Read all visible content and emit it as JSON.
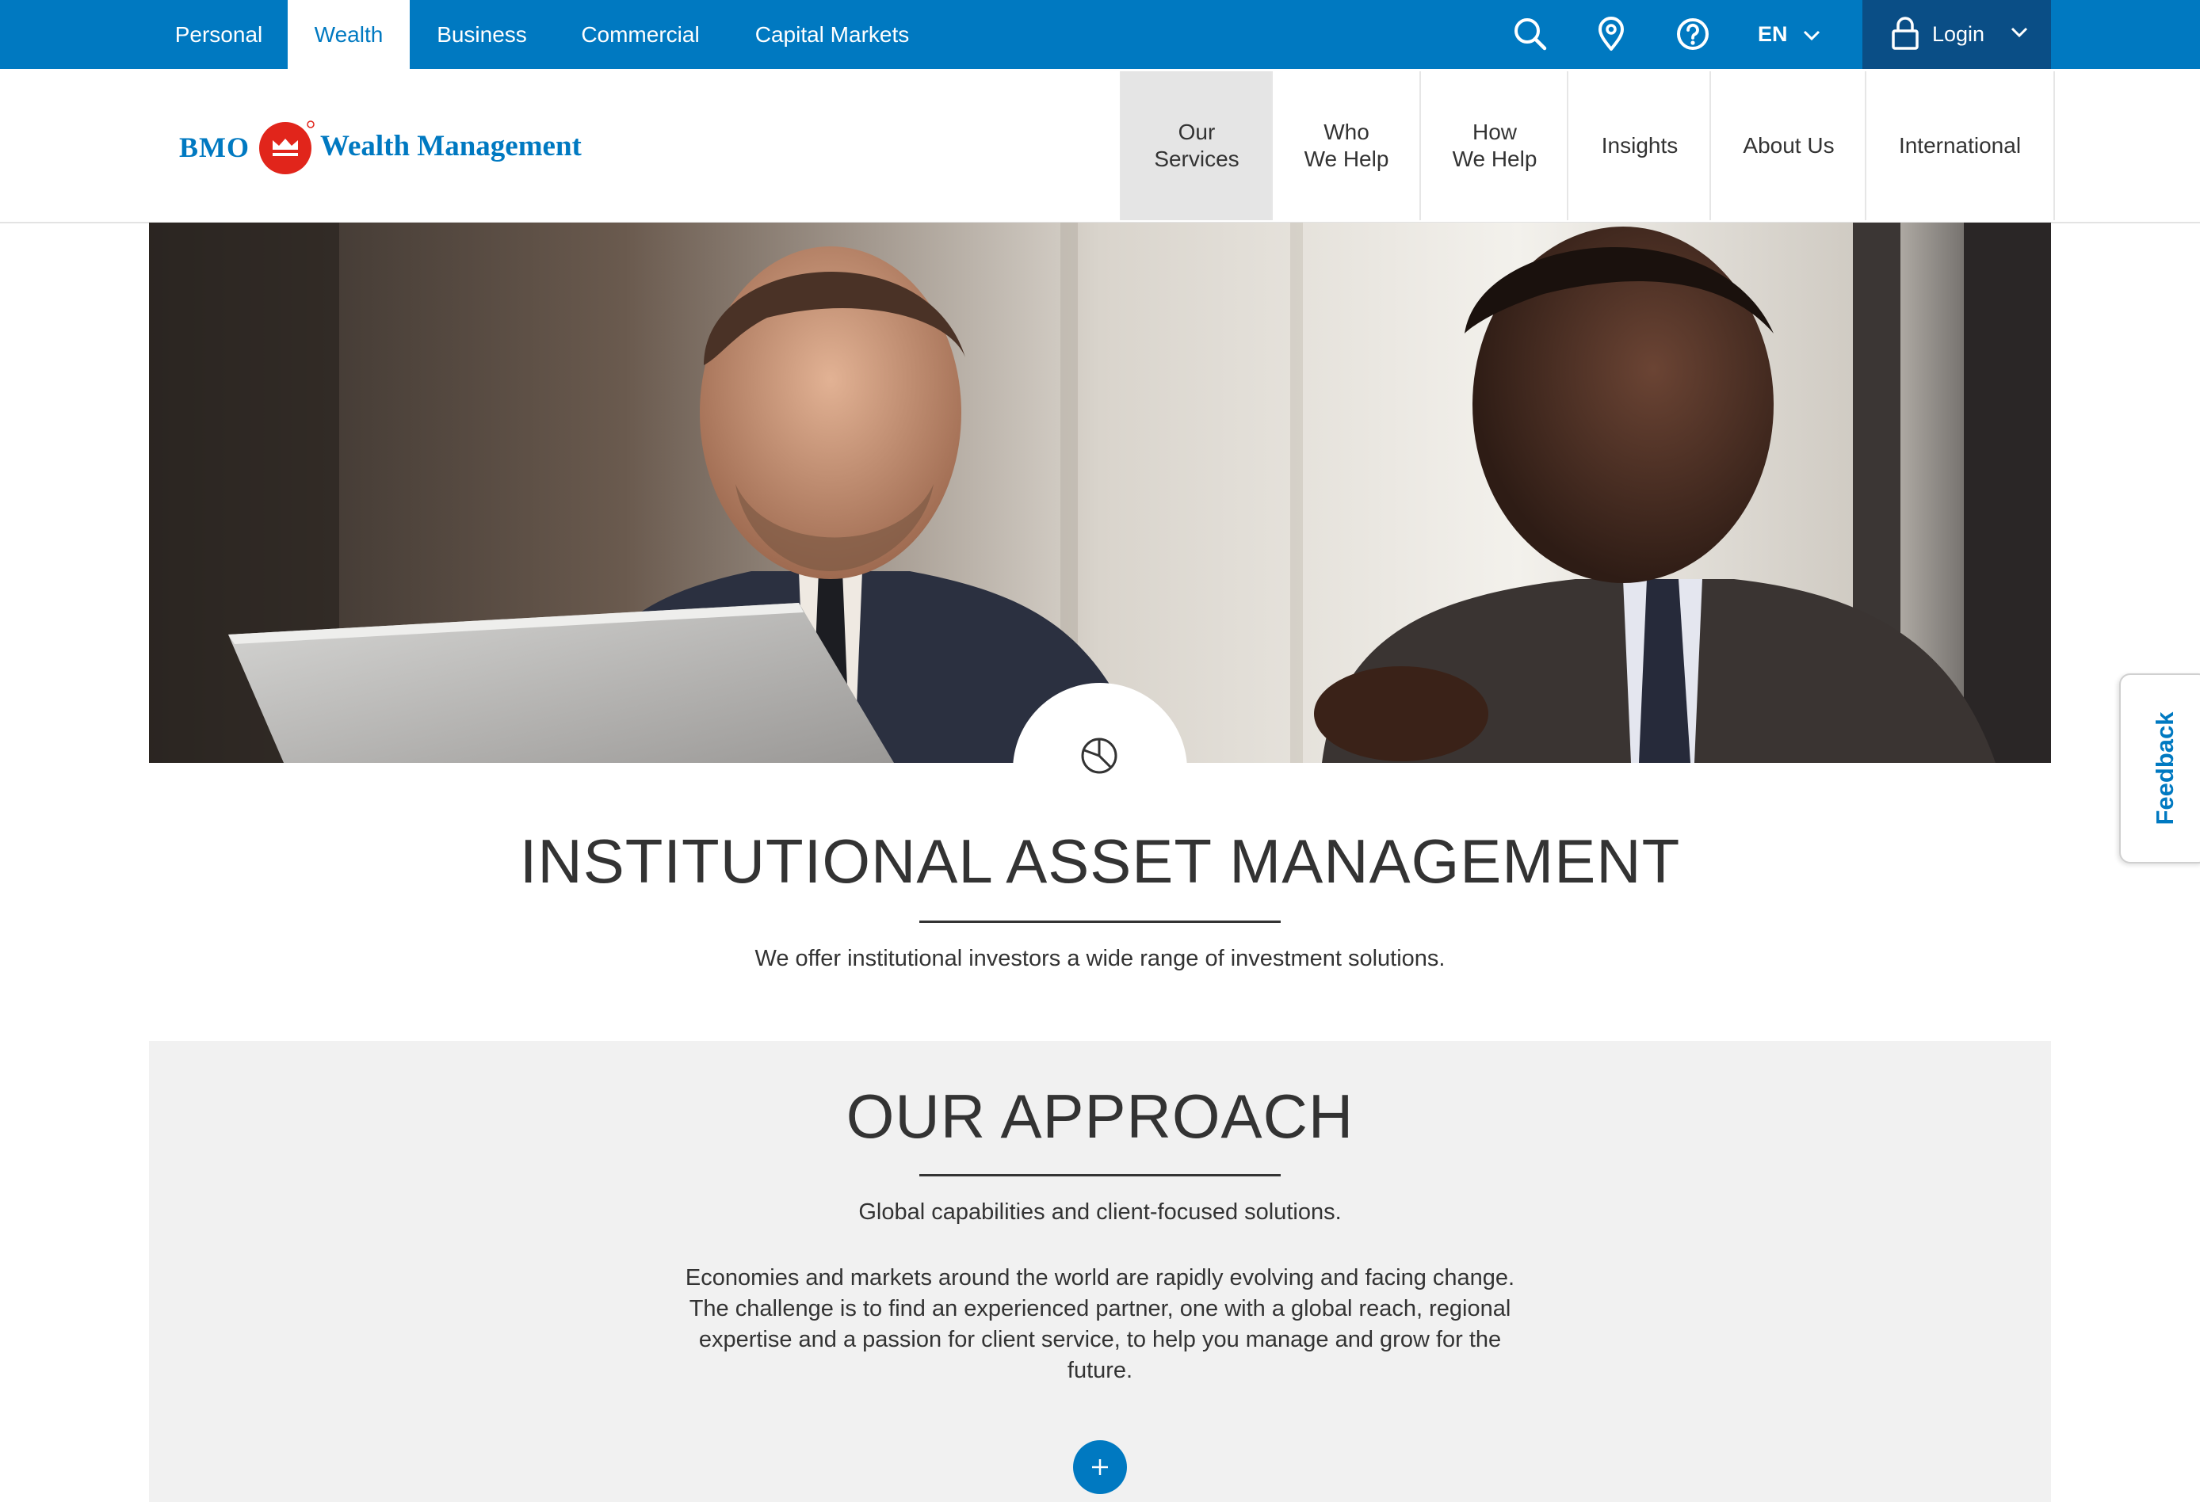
{
  "topnav": {
    "segments": [
      {
        "label": "Personal",
        "active": false
      },
      {
        "label": "Wealth",
        "active": true
      },
      {
        "label": "Business",
        "active": false
      },
      {
        "label": "Commercial",
        "active": false
      },
      {
        "label": "Capital Markets",
        "active": false
      }
    ],
    "icons": [
      "search-icon",
      "location-pin-icon",
      "help-icon"
    ],
    "language": "EN",
    "login_label": "Login"
  },
  "brand": {
    "bank": "BMO",
    "name": "Wealth Management",
    "colors": {
      "primary": "#0079c1",
      "roundel": "#e1251b",
      "login_bg": "#0a4e86"
    }
  },
  "mainnav": {
    "items": [
      {
        "label": "Our\nServices",
        "active": true
      },
      {
        "label": "Who\nWe Help",
        "active": false
      },
      {
        "label": "How\nWe Help",
        "active": false
      },
      {
        "label": "Insights",
        "active": false
      },
      {
        "label": "About Us",
        "active": false
      },
      {
        "label": "International",
        "active": false
      }
    ]
  },
  "hero": {
    "icon": "pie-chart-icon"
  },
  "intro": {
    "title": "INSTITUTIONAL ASSET MANAGEMENT",
    "lede": "We offer institutional investors a wide range of investment solutions."
  },
  "approach": {
    "title": "OUR APPROACH",
    "subtitle": "Global capabilities and client-focused solutions.",
    "body": "Economies and markets around the world are rapidly evolving and facing change. The challenge is to find an experienced partner, one with a global reach, regional expertise and a passion for client service, to help you manage and grow for the future.",
    "expand_icon": "plus-icon"
  },
  "feedback": {
    "label": "Feedback"
  }
}
